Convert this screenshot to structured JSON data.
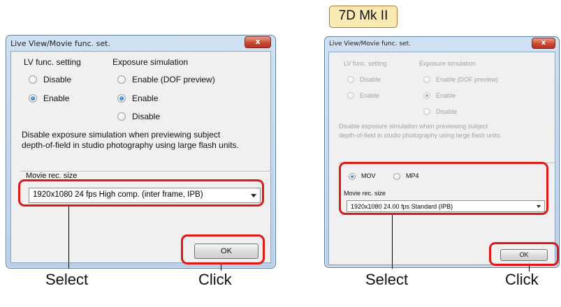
{
  "badge": {
    "label": "7D Mk II"
  },
  "left_dialog": {
    "title": "Live View/Movie func. set.",
    "close_label": "x",
    "lv_heading": "LV func. setting",
    "exp_heading": "Exposure simulation",
    "lv_options": [
      "Disable",
      "Enable"
    ],
    "exp_options": [
      "Enable (DOF preview)",
      "Enable",
      "Disable"
    ],
    "note_line1": "Disable exposure simulation when previewing subject",
    "note_line2": "depth-of-field in studio photography using large flash units.",
    "movie_size_label": "Movie rec. size",
    "movie_size_value": "1920x1080  24 fps High comp. (inter frame, IPB)",
    "ok_label": "OK"
  },
  "right_dialog": {
    "title": "Live View/Movie func. set.",
    "close_label": "x",
    "lv_heading": "LV func. setting",
    "exp_heading": "Exposure simulation",
    "lv_options": [
      "Disable",
      "Enable"
    ],
    "exp_options": [
      "Enable (DOF preview)",
      "Enable",
      "Disable"
    ],
    "note_line1": "Disable exposure simulation when previewing subject",
    "note_line2": "depth-of-field in studio photography using large flash units.",
    "format_options": [
      "MOV",
      "MP4"
    ],
    "movie_size_label": "Movie rec. size",
    "movie_size_value": "1920x1080  24.00 fps Standard (IPB)",
    "ok_label": "OK"
  },
  "callouts": {
    "left_select": "Select",
    "left_click": "Click",
    "right_select": "Select",
    "right_click": "Click"
  },
  "colors": {
    "highlight": "#e01818",
    "badge_fill": "#fbe9b4",
    "close_button": "#c84a33"
  }
}
